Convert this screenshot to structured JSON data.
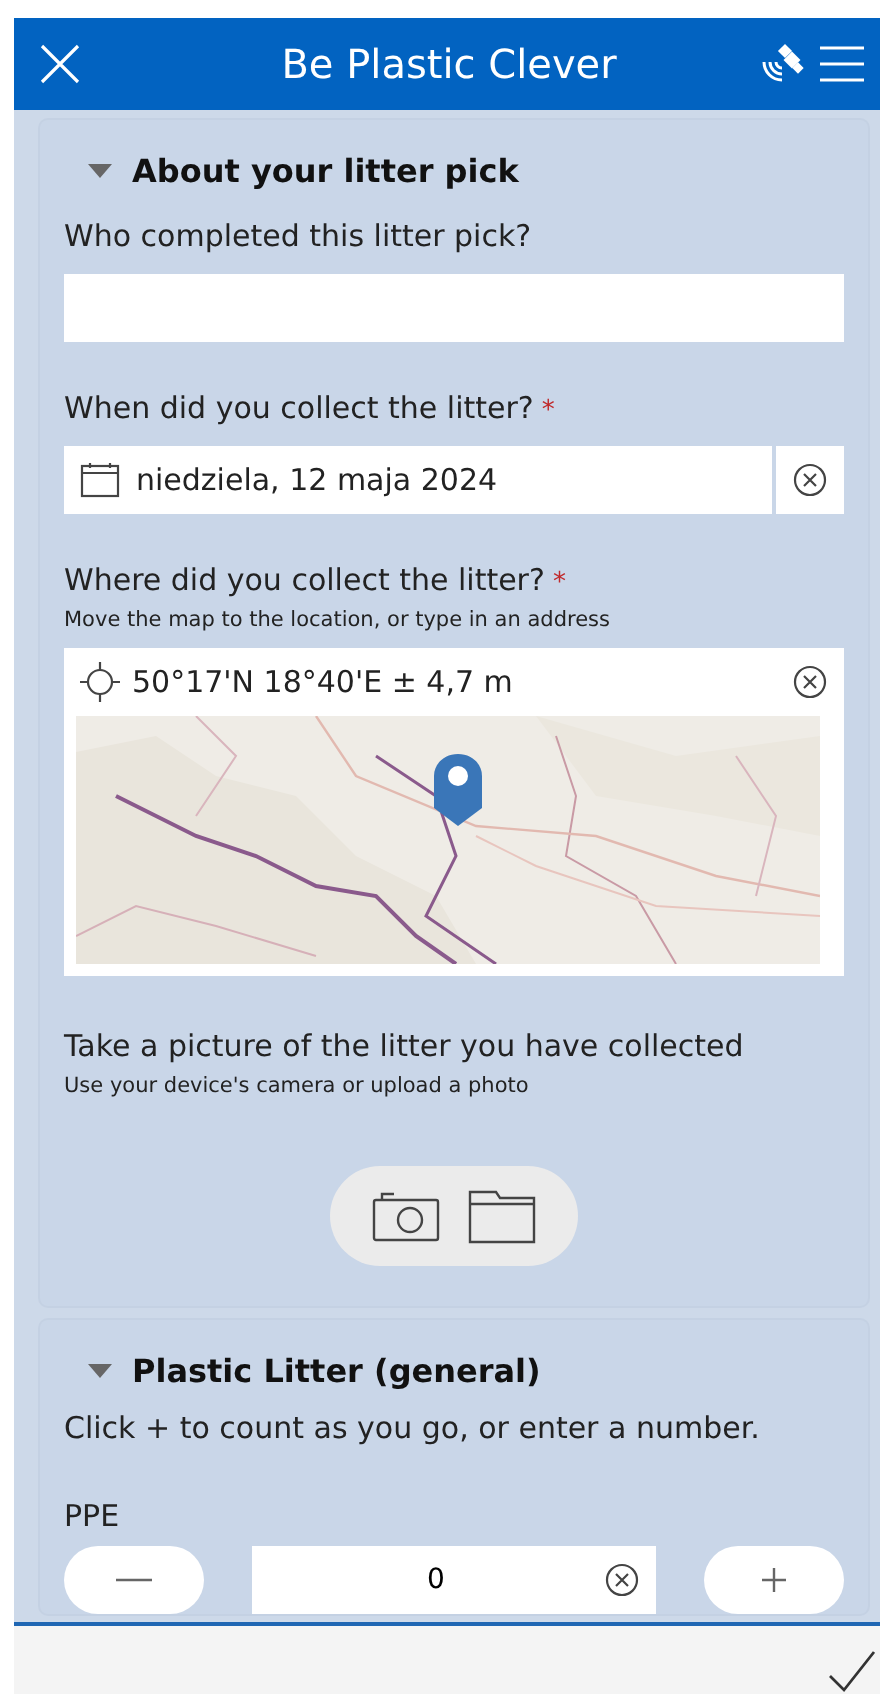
{
  "header": {
    "title": "Be Plastic Clever"
  },
  "sections": [
    {
      "title": "About your litter pick",
      "expanded": true,
      "questions": [
        {
          "kind": "text",
          "label": "Who completed this litter pick?"
        },
        {
          "kind": "date",
          "label": "When did you collect the litter?",
          "required_mark": "*",
          "value": "niedziela, 12 maja 2024"
        },
        {
          "kind": "location",
          "label": "Where did you collect the litter?",
          "required_mark": "*",
          "hint": "Move the map to the location, or type in an address",
          "value": "50°17'N 18°40'E ± 4,7 m"
        },
        {
          "label": "Take a picture of the litter you have collected",
          "hint": "Use your device's camera or upload a photo"
        }
      ]
    },
    {
      "title": "Plastic Litter (general)",
      "expanded": true,
      "intro": "Click + to count as you go, or enter a number.",
      "questions": [
        {
          "kind": "counter",
          "label": "PPE",
          "value": "0"
        }
      ]
    }
  ]
}
